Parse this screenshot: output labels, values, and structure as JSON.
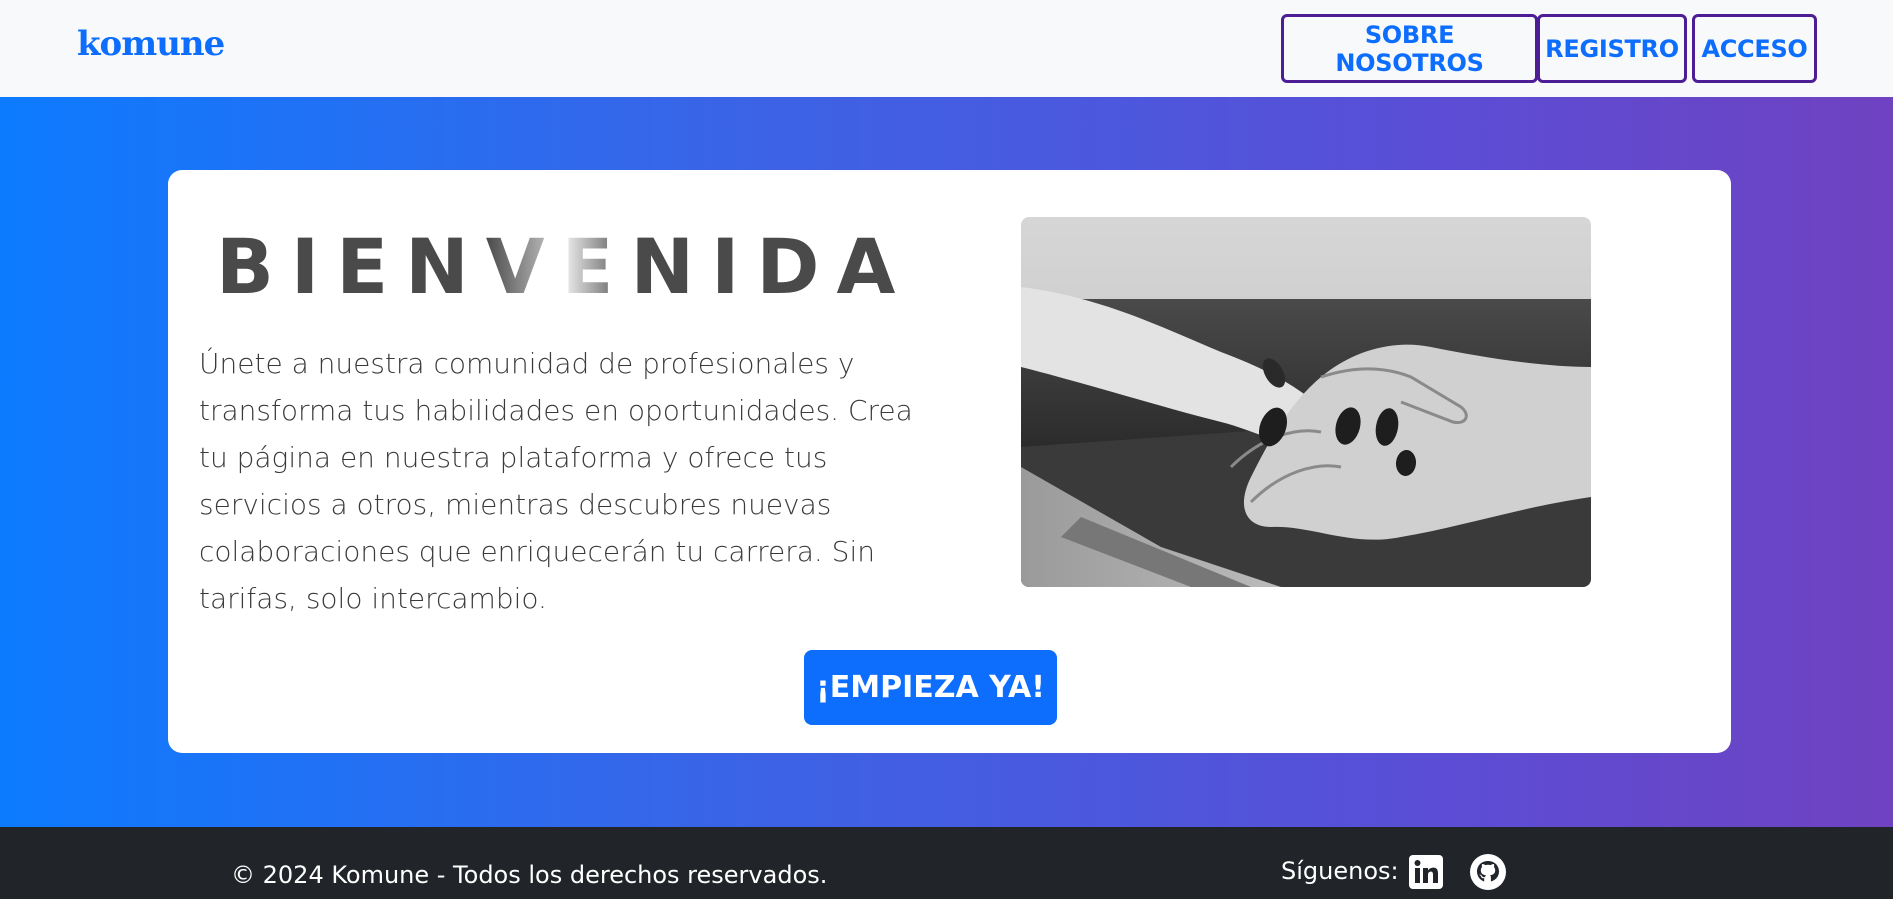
{
  "navbar": {
    "brand": "komune",
    "links": [
      "SOBRE NOSOTROS",
      "REGISTRO",
      "ACCESO"
    ]
  },
  "hero": {
    "title_parts": [
      "BIEN",
      "VE",
      "NIDA"
    ],
    "description": "Únete a nuestra comunidad de profesionales y transforma tus habilidades en oportunidades. Crea tu página en nuestra plataforma y ofrece tus servicios a otros, mientras descubres nuevas colaboraciones que enriquecerán tu carrera. Sin tarifas, solo intercambio.",
    "cta_label": "¡EMPIEZA YA!"
  },
  "footer": {
    "copyright": "© 2024 Komune - Todos los derechos reservados.",
    "follow_label": "Síguenos:",
    "social_icons": [
      "linkedin-icon",
      "github-icon"
    ]
  },
  "colors": {
    "brand": "#0d6efd",
    "nav_border": "#4c1d95",
    "gradient_start": "#0d7bff",
    "gradient_end": "#6f42c1",
    "footer_bg": "#212529"
  }
}
